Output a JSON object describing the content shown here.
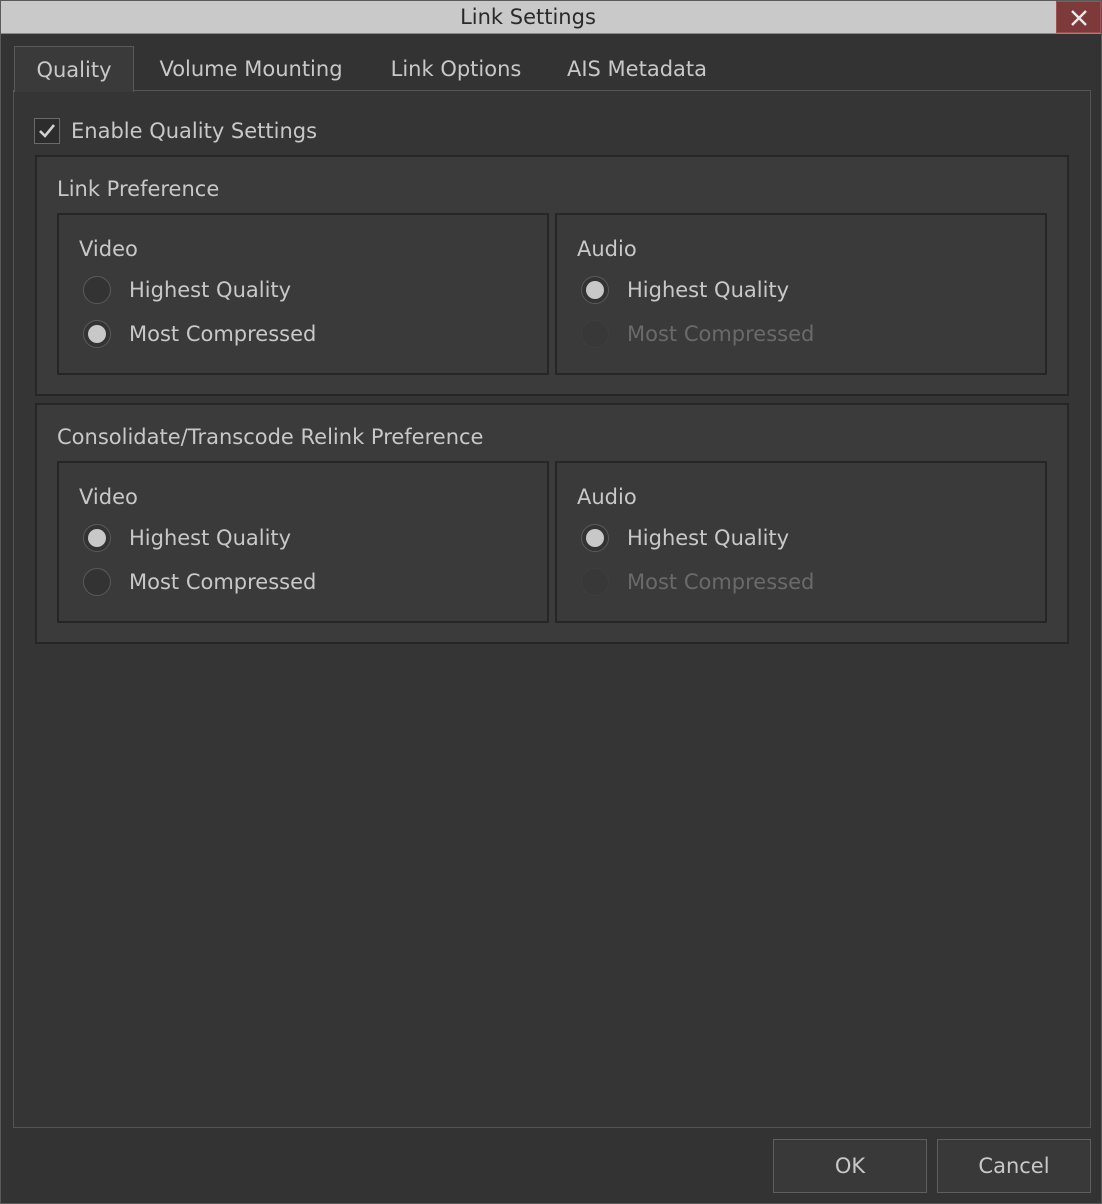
{
  "window": {
    "title": "Link Settings"
  },
  "tabs": [
    {
      "label": "Quality",
      "active": true
    },
    {
      "label": "Volume Mounting",
      "active": false
    },
    {
      "label": "Link Options",
      "active": false
    },
    {
      "label": "AIS Metadata",
      "active": false
    }
  ],
  "quality": {
    "enable_label": "Enable Quality Settings",
    "enable_checked": true,
    "link_preference": {
      "title": "Link Preference",
      "video": {
        "title": "Video",
        "options": [
          {
            "label": "Highest Quality",
            "selected": false,
            "enabled": true
          },
          {
            "label": "Most Compressed",
            "selected": true,
            "enabled": true
          }
        ]
      },
      "audio": {
        "title": "Audio",
        "options": [
          {
            "label": "Highest Quality",
            "selected": true,
            "enabled": true
          },
          {
            "label": "Most Compressed",
            "selected": false,
            "enabled": false
          }
        ]
      }
    },
    "relink_preference": {
      "title": "Consolidate/Transcode Relink Preference",
      "video": {
        "title": "Video",
        "options": [
          {
            "label": "Highest Quality",
            "selected": true,
            "enabled": true
          },
          {
            "label": "Most Compressed",
            "selected": false,
            "enabled": true
          }
        ]
      },
      "audio": {
        "title": "Audio",
        "options": [
          {
            "label": "Highest Quality",
            "selected": true,
            "enabled": true
          },
          {
            "label": "Most Compressed",
            "selected": false,
            "enabled": false
          }
        ]
      }
    }
  },
  "buttons": {
    "ok_label": "OK",
    "cancel_label": "Cancel"
  },
  "colors": {
    "background": "#333333",
    "titlebar": "#c9c9c9",
    "close": "#7c3a3a",
    "text": "#c8c8c8",
    "disabled_text": "#6a6a6a"
  }
}
